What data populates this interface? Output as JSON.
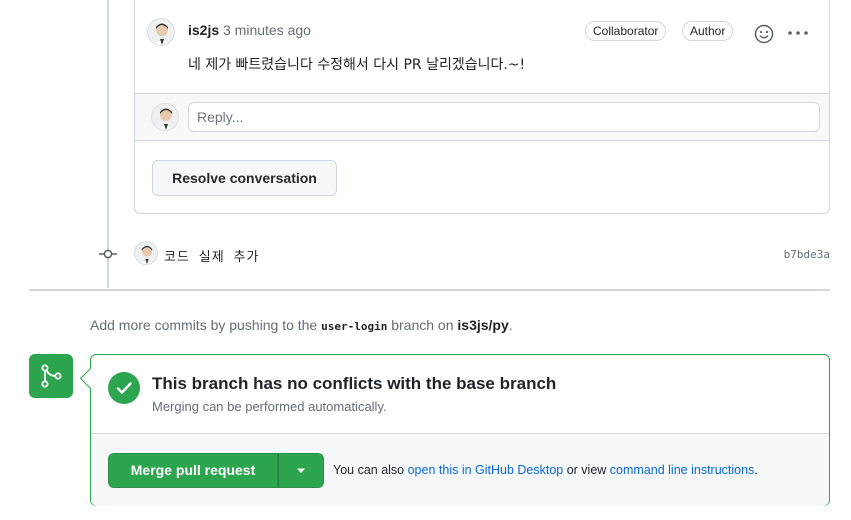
{
  "thread": {
    "comment": {
      "author": "is2js",
      "time": "3 minutes ago",
      "badges": [
        "Collaborator",
        "Author"
      ],
      "body": "네 제가 빠트렸습니다 수정해서 다시 PR 날리겠습니다.~!"
    },
    "reply_placeholder": "Reply...",
    "resolve_label": "Resolve conversation"
  },
  "commit": {
    "message": "코드 실제 추가",
    "sha": "b7bde3a"
  },
  "hint": {
    "prefix": "Add more commits by pushing to the ",
    "branch": "user-login",
    "middle": " branch on ",
    "repo": "is3js/py",
    "suffix": "."
  },
  "merge": {
    "title": "This branch has no conflicts with the base branch",
    "subtitle": "Merging can be performed automatically.",
    "button_label": "Merge pull request",
    "note_prefix": "You can also ",
    "desktop_link": "open this in GitHub Desktop",
    "note_middle": " or view ",
    "cli_link": "command line instructions",
    "note_suffix": "."
  },
  "colors": {
    "success": "#2da44e",
    "link": "#0969da",
    "border": "#d0d7de",
    "muted": "#656d76"
  },
  "icons": [
    "emoji-icon",
    "kebab-icon",
    "commit-icon",
    "git-branch-icon",
    "check-icon",
    "triangle-down-icon"
  ]
}
